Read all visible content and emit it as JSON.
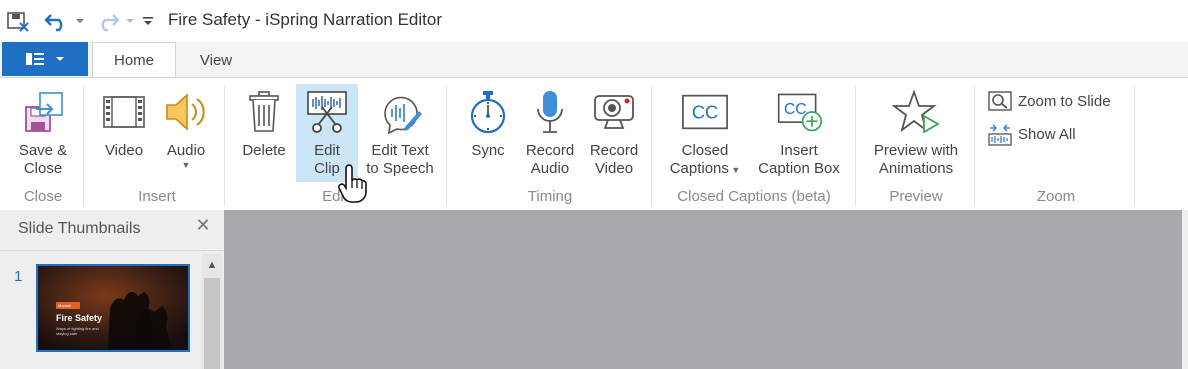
{
  "window": {
    "title": "Fire Safety - iSpring Narration Editor"
  },
  "quick_access": {
    "icons": [
      "save-icon",
      "undo-icon",
      "redo-icon",
      "customize-icon"
    ]
  },
  "tabs": [
    {
      "label": "Home",
      "active": true
    },
    {
      "label": "View",
      "active": false
    }
  ],
  "ribbon": {
    "groups": [
      {
        "label": "Close"
      },
      {
        "label": "Insert"
      },
      {
        "label": "Edit"
      },
      {
        "label": "Timing"
      },
      {
        "label": "Closed Captions (beta)"
      },
      {
        "label": "Preview"
      },
      {
        "label": "Zoom"
      }
    ],
    "buttons": {
      "save_close": {
        "line1": "Save &",
        "line2": "Close"
      },
      "video": {
        "label": "Video"
      },
      "audio": {
        "label": "Audio"
      },
      "delete": {
        "label": "Delete"
      },
      "edit_clip": {
        "line1": "Edit",
        "line2": "Clip"
      },
      "edit_text_speech": {
        "line1": "Edit Text",
        "line2": "to Speech"
      },
      "sync": {
        "label": "Sync"
      },
      "record_audio": {
        "line1": "Record",
        "line2": "Audio"
      },
      "record_video": {
        "line1": "Record",
        "line2": "Video"
      },
      "closed_captions": {
        "line1": "Closed",
        "line2": "Captions"
      },
      "insert_caption_box": {
        "line1": "Insert",
        "line2": "Caption Box"
      },
      "preview_animations": {
        "line1": "Preview with",
        "line2": "Animations"
      },
      "zoom_to_slide": {
        "label": "Zoom to Slide"
      },
      "show_all": {
        "label": "Show All"
      }
    }
  },
  "slide_panel": {
    "title": "Slide Thumbnails",
    "slides": [
      {
        "number": "1",
        "badge": "Module",
        "heading": "Fire Safety",
        "body": "Ways of fighting fire and staying safe"
      }
    ]
  },
  "colors": {
    "accent": "#1f6fc3",
    "active_button": "#cde6f7",
    "stage": "#a7a9ae"
  }
}
